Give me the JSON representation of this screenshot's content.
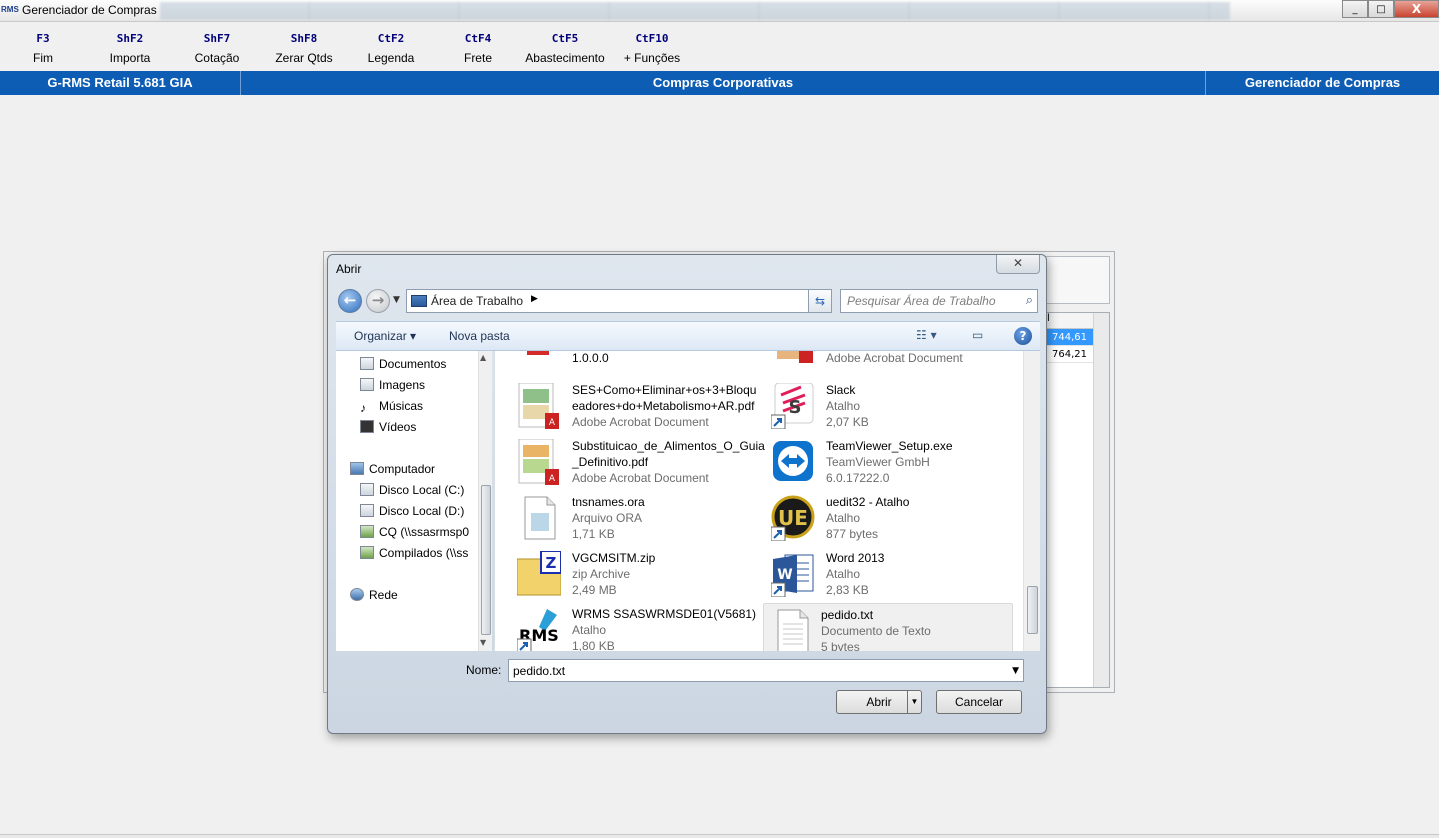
{
  "window": {
    "logo": "RMS",
    "title": "Gerenciador de Compras",
    "buttons": {
      "minimize": "_",
      "maximize": "□",
      "close": "X"
    }
  },
  "fkeys": [
    {
      "key": "F3",
      "label": "Fim"
    },
    {
      "key": "ShF2",
      "label": "Importa"
    },
    {
      "key": "ShF7",
      "label": "Cotação"
    },
    {
      "key": "ShF8",
      "label": "Zerar Qtds"
    },
    {
      "key": "CtF2",
      "label": "Legenda"
    },
    {
      "key": "CtF4",
      "label": "Frete"
    },
    {
      "key": "CtF5",
      "label": "Abastecimento"
    },
    {
      "key": "CtF10",
      "label": "+ Funções"
    }
  ],
  "header": {
    "left": "G-RMS Retail 5.681 GIA",
    "center": "Compras Corporativas",
    "right": "Gerenciador de Compras"
  },
  "background_table": {
    "header": "tal",
    "rows": [
      "744,61",
      "764,21"
    ]
  },
  "dialog": {
    "title": "Abrir",
    "close": "✕",
    "address": "Área de Trabalho",
    "search_placeholder": "Pesquisar Área de Trabalho",
    "toolbar": {
      "organize": "Organizar ▾",
      "new_folder": "Nova pasta",
      "help": "?"
    },
    "nav": {
      "documents": "Documentos",
      "images": "Imagens",
      "music": "Músicas",
      "videos": "Vídeos",
      "computer": "Computador",
      "disk_c": "Disco Local (C:)",
      "disk_d": "Disco Local (D:)",
      "cq": "CQ (\\\\ssasrmsp0",
      "compilados": "Compilados (\\\\ss",
      "network": "Rede"
    },
    "files_left": [
      {
        "l1": "1.0.0.0",
        "l2": "",
        "l3": ""
      },
      {
        "l1": "SES+Como+Eliminar+os+3+Bloqu",
        "l2": "eadores+do+Metabolismo+AR.pdf",
        "l3": "Adobe Acrobat Document"
      },
      {
        "l1": "Substituicao_de_Alimentos_O_Guia",
        "l2": "_Definitivo.pdf",
        "l3": "Adobe Acrobat Document"
      },
      {
        "l1": "tnsnames.ora",
        "l2": "Arquivo ORA",
        "l3": "1,71 KB"
      },
      {
        "l1": "VGCMSITM.zip",
        "l2": "zip Archive",
        "l3": "2,49 MB"
      },
      {
        "l1": "WRMS SSASWRMSDE01(V5681)",
        "l2": "Atalho",
        "l3": "1,80 KB"
      }
    ],
    "files_right": [
      {
        "l1": "Adobe Acrobat Document",
        "l2": "",
        "l3": ""
      },
      {
        "l1": "Slack",
        "l2": "Atalho",
        "l3": "2,07 KB"
      },
      {
        "l1": "TeamViewer_Setup.exe",
        "l2": "TeamViewer GmbH",
        "l3": "6.0.17222.0"
      },
      {
        "l1": "uedit32 - Atalho",
        "l2": "Atalho",
        "l3": "877 bytes"
      },
      {
        "l1": "Word 2013",
        "l2": "Atalho",
        "l3": "2,83 KB"
      },
      {
        "l1": "pedido.txt",
        "l2": "Documento de Texto",
        "l3": "5 bytes"
      }
    ],
    "name_label": "Nome:",
    "name_value": "pedido.txt",
    "open_label": "Abrir",
    "cancel_label": "Cancelar"
  }
}
